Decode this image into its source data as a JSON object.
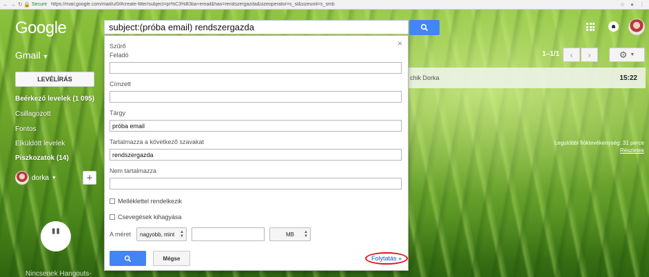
{
  "browser": {
    "secure_label": "Secure",
    "url": "https://mail.google.com/mail/u/0/#create-filter/subject=pr%C3%B3ba+email&has=rendszergazda&sizeoperator=s_sl&sizeunit=s_smb"
  },
  "header": {
    "logo": "Google",
    "search_value": "subject:(próba email) rendszergazda"
  },
  "nav": {
    "product": "Gmail",
    "compose": "LEVÉLÍRÁS",
    "items": [
      {
        "label": "Beérkező levelek (1 095)",
        "bold": true
      },
      {
        "label": "Csillagozott",
        "bold": false
      },
      {
        "label": "Fontos",
        "bold": false
      },
      {
        "label": "Elküldött levelek",
        "bold": false
      },
      {
        "label": "Piszkozatok (14)",
        "bold": true
      }
    ],
    "account_name": "dorka",
    "add_label": "+",
    "hangouts_text": "Nincsenek Hangouts-"
  },
  "toolbar": {
    "pager": "1–1/1"
  },
  "email_row": {
    "sender": "chik Dorka",
    "time": "15:22"
  },
  "activity": {
    "text": "Legutóbbi fióktevékenység: 31 perce",
    "link": "Részletek"
  },
  "filter": {
    "title": "Szűrő",
    "from_label": "Feladó",
    "from_value": "",
    "to_label": "Címzett",
    "to_value": "",
    "subject_label": "Tárgy",
    "subject_value": "próba email",
    "has_label": "Tartalmazza a következő szavakat",
    "has_value": "rendszergazda",
    "not_label": "Nem tartalmazza",
    "not_value": "",
    "attachment_label": "Melléklettel rendelkezik",
    "chats_label": "Csevegések kihagyása",
    "size_label": "A méret",
    "size_operator": "nagyobb, mint",
    "size_value": "",
    "size_unit": "MB",
    "cancel": "Mégse",
    "continue": "Folytatás »"
  },
  "colors": {
    "accent": "#4285f4",
    "highlight_ring": "#e0151a",
    "link": "#1155cc"
  }
}
